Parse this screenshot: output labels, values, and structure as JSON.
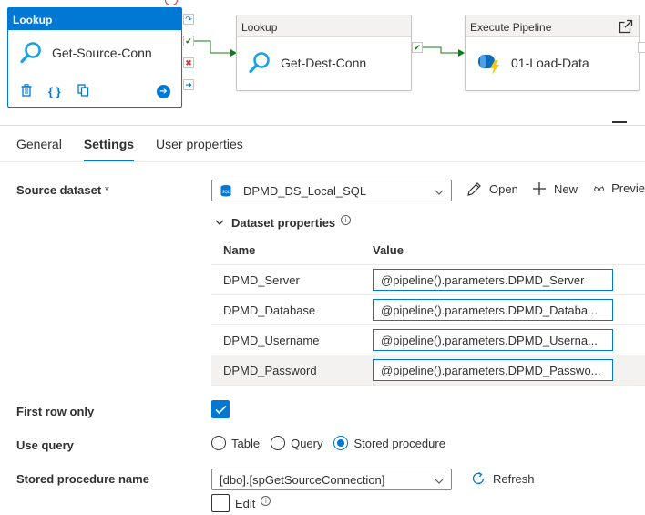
{
  "canvas": {
    "activities": [
      {
        "type": "Lookup",
        "name": "Get-Source-Conn",
        "tools": [
          "delete-icon",
          "code-icon",
          "copy-icon",
          "arrow-right-icon"
        ]
      },
      {
        "type": "Lookup",
        "name": "Get-Dest-Conn"
      },
      {
        "type": "Execute Pipeline",
        "name": "01-Load-Data"
      }
    ]
  },
  "tabs": [
    {
      "label": "General",
      "active": false
    },
    {
      "label": "Settings",
      "active": true
    },
    {
      "label": "User properties",
      "active": false
    }
  ],
  "settings": {
    "source_dataset_label": "Source dataset",
    "required_marker": "*",
    "source_dataset_value": "DPMD_DS_Local_SQL",
    "actions": {
      "open": "Open",
      "new": "New",
      "preview": "Previe"
    },
    "dataset_properties_label": "Dataset properties",
    "props_columns": {
      "name": "Name",
      "value": "Value"
    },
    "props": [
      {
        "name": "DPMD_Server",
        "value": "@pipeline().parameters.DPMD_Server"
      },
      {
        "name": "DPMD_Database",
        "value": "@pipeline().parameters.DPMD_Databa..."
      },
      {
        "name": "DPMD_Username",
        "value": "@pipeline().parameters.DPMD_Userna..."
      },
      {
        "name": "DPMD_Password",
        "value": "@pipeline().parameters.DPMD_Passwo..."
      }
    ],
    "first_row_only_label": "First row only",
    "first_row_only_checked": true,
    "use_query_label": "Use query",
    "use_query_options": [
      "Table",
      "Query",
      "Stored procedure"
    ],
    "use_query_selected": "Stored procedure",
    "stored_procedure_label": "Stored procedure name",
    "stored_procedure_value": "[dbo].[spGetSourceConnection]",
    "refresh_label": "Refresh",
    "edit_label": "Edit"
  },
  "colors": {
    "accent": "#0078d4",
    "success": "#107c10",
    "fail": "#d13438"
  }
}
